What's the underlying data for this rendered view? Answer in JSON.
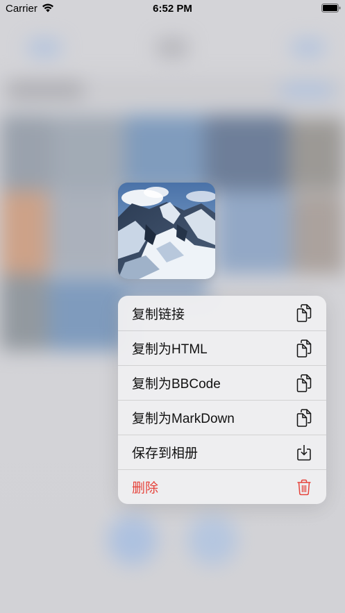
{
  "status_bar": {
    "carrier": "Carrier",
    "time": "6:52 PM"
  },
  "colors": {
    "destructive": "#e5423a",
    "text": "#111111",
    "menu_bg": "#eeeef0"
  },
  "menu": {
    "items": [
      {
        "label": "复制链接",
        "icon": "copy-icon"
      },
      {
        "label": "复制为HTML",
        "icon": "copy-icon"
      },
      {
        "label": "复制为BBCode",
        "icon": "copy-icon"
      },
      {
        "label": "复制为MarkDown",
        "icon": "copy-icon"
      },
      {
        "label": "保存到相册",
        "icon": "download-icon"
      },
      {
        "label": "删除",
        "icon": "trash-icon"
      }
    ]
  }
}
